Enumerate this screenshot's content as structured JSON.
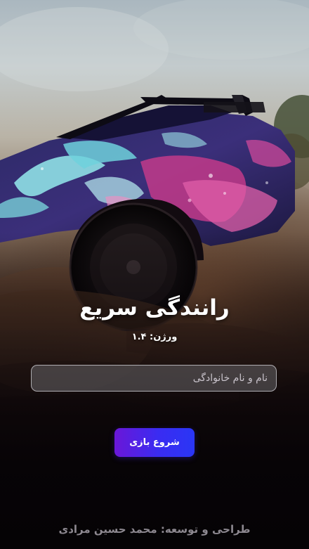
{
  "app": {
    "title": "رانندگی سریع",
    "version_text": "ورژن: ۱.۴"
  },
  "form": {
    "name_placeholder": "نام و نام خانوادگی",
    "name_value": ""
  },
  "actions": {
    "start_label": "شروع بازی"
  },
  "footer": {
    "credit": "طراحی و توسعه: محمد حسین مرادی"
  },
  "colors": {
    "button_gradient_start": "#6a17d8",
    "button_gradient_end": "#2a36f5",
    "title_text": "#ffffff",
    "credit_text": "#8d8890"
  },
  "icons": {
    "background": "rally-car-illustration"
  }
}
